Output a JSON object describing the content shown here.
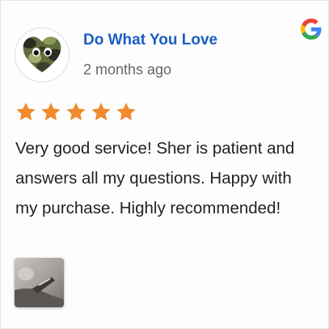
{
  "review": {
    "reviewer_name": "Do What You Love",
    "time_ago": "2 months ago",
    "rating": 5,
    "rating_max": 5,
    "text": "Very good service! Sher is patient and answers all my questions. Happy with my purchase. Highly recommended!",
    "photo_count": 1
  },
  "icons": {
    "source_logo": "google-g-icon",
    "star": "star-icon",
    "avatar": "camo-heart-avatar"
  },
  "colors": {
    "name": "#1a5ec2",
    "star": "#f08a2c",
    "text": "#222222",
    "time": "#666666"
  }
}
